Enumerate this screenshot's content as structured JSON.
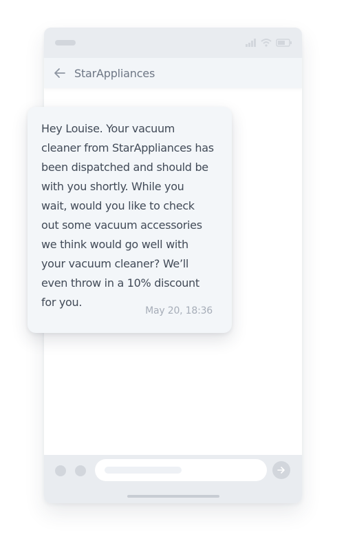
{
  "app": {
    "contact_name": "StarAppliances"
  },
  "status_icons": [
    "signal-icon",
    "wifi-icon",
    "battery-icon"
  ],
  "message": {
    "text": "Hey Louise. Your vacuum\ncleaner from StarAppliances has\nbeen dispatched and should be\nwith you shortly. While you\nwait, would you like to check\nout some vacuum accessories\nwe think would go well with\nyour vacuum cleaner? We’ll\neven throw in a 10% discount\nfor you.",
    "timestamp": "May 20, 18:36"
  },
  "colors": {
    "chrome": "#e9ecf0",
    "header": "#f2f5f8",
    "bubble": "#f3f6f9",
    "text": "#414a57",
    "muted": "#a6adb8"
  }
}
